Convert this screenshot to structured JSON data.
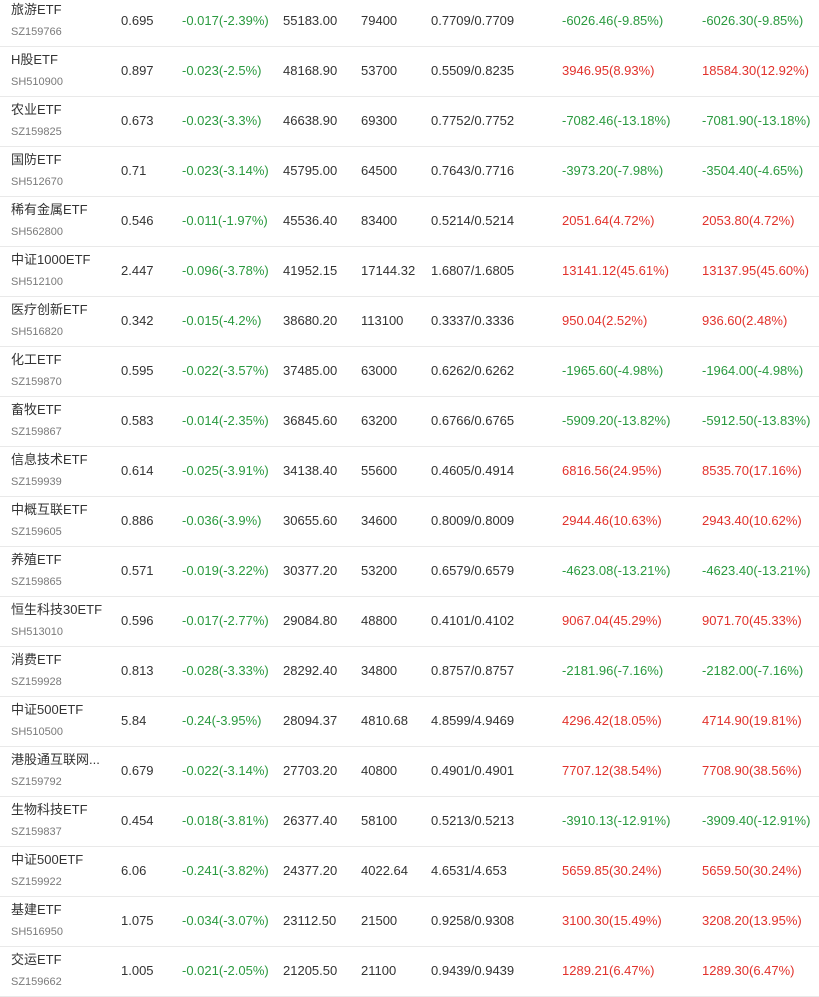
{
  "colors": {
    "negative": "#2a9a3f",
    "positive": "#e2322c",
    "text": "#333333",
    "subtext": "#7a7a7a",
    "divider": "#e9e9e9"
  },
  "rows": [
    {
      "name": "旅游ETF",
      "code": "SZ159766",
      "price": "0.695",
      "change": "-0.017(-2.39%)",
      "change_dir": "neg",
      "hold_value": "55183.00",
      "shares": "79400",
      "cost": "0.7709/0.7709",
      "pnl1": "-6026.46(-9.85%)",
      "pnl1_dir": "neg",
      "pnl2": "-6026.30(-9.85%)",
      "pnl2_dir": "neg"
    },
    {
      "name": "H股ETF",
      "code": "SH510900",
      "price": "0.897",
      "change": "-0.023(-2.5%)",
      "change_dir": "neg",
      "hold_value": "48168.90",
      "shares": "53700",
      "cost": "0.5509/0.8235",
      "pnl1": "3946.95(8.93%)",
      "pnl1_dir": "pos",
      "pnl2": "18584.30(12.92%)",
      "pnl2_dir": "pos"
    },
    {
      "name": "农业ETF",
      "code": "SZ159825",
      "price": "0.673",
      "change": "-0.023(-3.3%)",
      "change_dir": "neg",
      "hold_value": "46638.90",
      "shares": "69300",
      "cost": "0.7752/0.7752",
      "pnl1": "-7082.46(-13.18%)",
      "pnl1_dir": "neg",
      "pnl2": "-7081.90(-13.18%)",
      "pnl2_dir": "neg"
    },
    {
      "name": "国防ETF",
      "code": "SH512670",
      "price": "0.71",
      "change": "-0.023(-3.14%)",
      "change_dir": "neg",
      "hold_value": "45795.00",
      "shares": "64500",
      "cost": "0.7643/0.7716",
      "pnl1": "-3973.20(-7.98%)",
      "pnl1_dir": "neg",
      "pnl2": "-3504.40(-4.65%)",
      "pnl2_dir": "neg"
    },
    {
      "name": "稀有金属ETF",
      "code": "SH562800",
      "price": "0.546",
      "change": "-0.011(-1.97%)",
      "change_dir": "neg",
      "hold_value": "45536.40",
      "shares": "83400",
      "cost": "0.5214/0.5214",
      "pnl1": "2051.64(4.72%)",
      "pnl1_dir": "pos",
      "pnl2": "2053.80(4.72%)",
      "pnl2_dir": "pos"
    },
    {
      "name": "中证1000ETF",
      "code": "SH512100",
      "price": "2.447",
      "change": "-0.096(-3.78%)",
      "change_dir": "neg",
      "hold_value": "41952.15",
      "shares": "17144.32",
      "cost": "1.6807/1.6805",
      "pnl1": "13141.12(45.61%)",
      "pnl1_dir": "pos",
      "pnl2": "13137.95(45.60%)",
      "pnl2_dir": "pos"
    },
    {
      "name": "医疗创新ETF",
      "code": "SH516820",
      "price": "0.342",
      "change": "-0.015(-4.2%)",
      "change_dir": "neg",
      "hold_value": "38680.20",
      "shares": "113100",
      "cost": "0.3337/0.3336",
      "pnl1": "950.04(2.52%)",
      "pnl1_dir": "pos",
      "pnl2": "936.60(2.48%)",
      "pnl2_dir": "pos"
    },
    {
      "name": "化工ETF",
      "code": "SZ159870",
      "price": "0.595",
      "change": "-0.022(-3.57%)",
      "change_dir": "neg",
      "hold_value": "37485.00",
      "shares": "63000",
      "cost": "0.6262/0.6262",
      "pnl1": "-1965.60(-4.98%)",
      "pnl1_dir": "neg",
      "pnl2": "-1964.00(-4.98%)",
      "pnl2_dir": "neg"
    },
    {
      "name": "畜牧ETF",
      "code": "SZ159867",
      "price": "0.583",
      "change": "-0.014(-2.35%)",
      "change_dir": "neg",
      "hold_value": "36845.60",
      "shares": "63200",
      "cost": "0.6766/0.6765",
      "pnl1": "-5909.20(-13.82%)",
      "pnl1_dir": "neg",
      "pnl2": "-5912.50(-13.83%)",
      "pnl2_dir": "neg"
    },
    {
      "name": "信息技术ETF",
      "code": "SZ159939",
      "price": "0.614",
      "change": "-0.025(-3.91%)",
      "change_dir": "neg",
      "hold_value": "34138.40",
      "shares": "55600",
      "cost": "0.4605/0.4914",
      "pnl1": "6816.56(24.95%)",
      "pnl1_dir": "pos",
      "pnl2": "8535.70(17.16%)",
      "pnl2_dir": "pos"
    },
    {
      "name": "中概互联ETF",
      "code": "SZ159605",
      "price": "0.886",
      "change": "-0.036(-3.9%)",
      "change_dir": "neg",
      "hold_value": "30655.60",
      "shares": "34600",
      "cost": "0.8009/0.8009",
      "pnl1": "2944.46(10.63%)",
      "pnl1_dir": "pos",
      "pnl2": "2943.40(10.62%)",
      "pnl2_dir": "pos"
    },
    {
      "name": "养殖ETF",
      "code": "SZ159865",
      "price": "0.571",
      "change": "-0.019(-3.22%)",
      "change_dir": "neg",
      "hold_value": "30377.20",
      "shares": "53200",
      "cost": "0.6579/0.6579",
      "pnl1": "-4623.08(-13.21%)",
      "pnl1_dir": "neg",
      "pnl2": "-4623.40(-13.21%)",
      "pnl2_dir": "neg"
    },
    {
      "name": "恒生科技30ETF",
      "code": "SH513010",
      "price": "0.596",
      "change": "-0.017(-2.77%)",
      "change_dir": "neg",
      "hold_value": "29084.80",
      "shares": "48800",
      "cost": "0.4101/0.4102",
      "pnl1": "9067.04(45.29%)",
      "pnl1_dir": "pos",
      "pnl2": "9071.70(45.33%)",
      "pnl2_dir": "pos"
    },
    {
      "name": "消费ETF",
      "code": "SZ159928",
      "price": "0.813",
      "change": "-0.028(-3.33%)",
      "change_dir": "neg",
      "hold_value": "28292.40",
      "shares": "34800",
      "cost": "0.8757/0.8757",
      "pnl1": "-2181.96(-7.16%)",
      "pnl1_dir": "neg",
      "pnl2": "-2182.00(-7.16%)",
      "pnl2_dir": "neg"
    },
    {
      "name": "中证500ETF",
      "code": "SH510500",
      "price": "5.84",
      "change": "-0.24(-3.95%)",
      "change_dir": "neg",
      "hold_value": "28094.37",
      "shares": "4810.68",
      "cost": "4.8599/4.9469",
      "pnl1": "4296.42(18.05%)",
      "pnl1_dir": "pos",
      "pnl2": "4714.90(19.81%)",
      "pnl2_dir": "pos"
    },
    {
      "name": "港股通互联网...",
      "code": "SZ159792",
      "price": "0.679",
      "change": "-0.022(-3.14%)",
      "change_dir": "neg",
      "hold_value": "27703.20",
      "shares": "40800",
      "cost": "0.4901/0.4901",
      "pnl1": "7707.12(38.54%)",
      "pnl1_dir": "pos",
      "pnl2": "7708.90(38.56%)",
      "pnl2_dir": "pos"
    },
    {
      "name": "生物科技ETF",
      "code": "SZ159837",
      "price": "0.454",
      "change": "-0.018(-3.81%)",
      "change_dir": "neg",
      "hold_value": "26377.40",
      "shares": "58100",
      "cost": "0.5213/0.5213",
      "pnl1": "-3910.13(-12.91%)",
      "pnl1_dir": "neg",
      "pnl2": "-3909.40(-12.91%)",
      "pnl2_dir": "neg"
    },
    {
      "name": "中证500ETF",
      "code": "SZ159922",
      "price": "6.06",
      "change": "-0.241(-3.82%)",
      "change_dir": "neg",
      "hold_value": "24377.20",
      "shares": "4022.64",
      "cost": "4.6531/4.653",
      "pnl1": "5659.85(30.24%)",
      "pnl1_dir": "pos",
      "pnl2": "5659.50(30.24%)",
      "pnl2_dir": "pos"
    },
    {
      "name": "基建ETF",
      "code": "SH516950",
      "price": "1.075",
      "change": "-0.034(-3.07%)",
      "change_dir": "neg",
      "hold_value": "23112.50",
      "shares": "21500",
      "cost": "0.9258/0.9308",
      "pnl1": "3100.30(15.49%)",
      "pnl1_dir": "pos",
      "pnl2": "3208.20(13.95%)",
      "pnl2_dir": "pos"
    },
    {
      "name": "交运ETF",
      "code": "SZ159662",
      "price": "1.005",
      "change": "-0.021(-2.05%)",
      "change_dir": "neg",
      "hold_value": "21205.50",
      "shares": "21100",
      "cost": "0.9439/0.9439",
      "pnl1": "1289.21(6.47%)",
      "pnl1_dir": "pos",
      "pnl2": "1289.30(6.47%)",
      "pnl2_dir": "pos"
    }
  ]
}
